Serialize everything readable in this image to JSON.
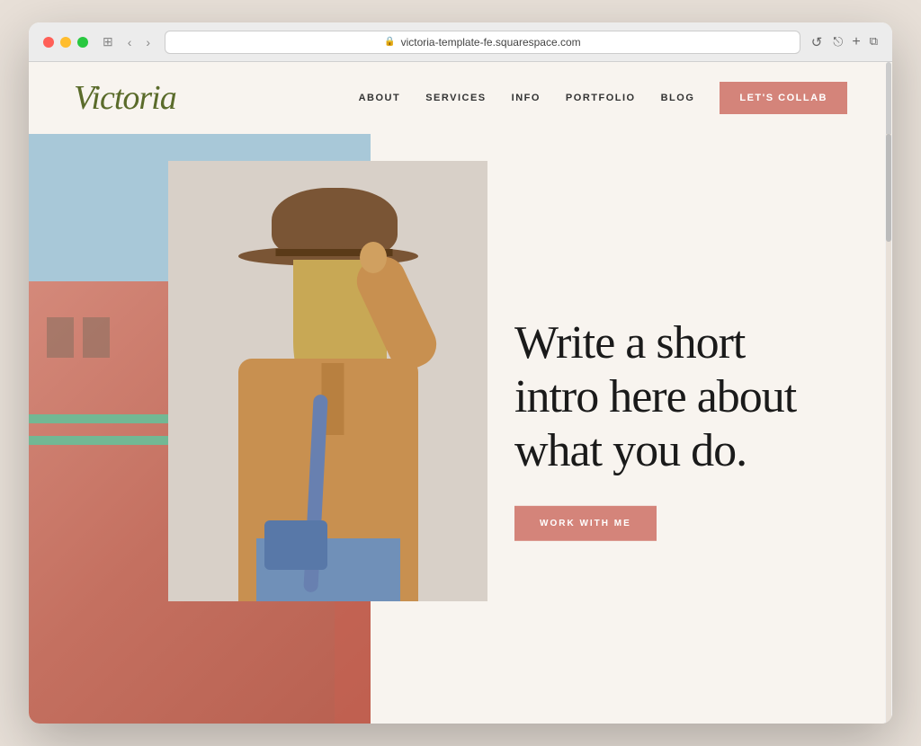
{
  "browser": {
    "url": "victoria-template-fe.squarespace.com",
    "reload_label": "↺",
    "back_label": "‹",
    "forward_label": "›",
    "window_icon": "⊞"
  },
  "header": {
    "logo": "Victoria",
    "nav": {
      "about_label": "ABOUT",
      "services_label": "SERVICES",
      "info_label": "INFO",
      "portfolio_label": "PORTFOLIO",
      "blog_label": "BLOG",
      "cta_label": "LET'S COLLAB"
    }
  },
  "hero": {
    "headline": "Write a short intro here about what you do.",
    "cta_label": "WORK WITH ME"
  },
  "colors": {
    "accent": "#d4847a",
    "logo_green": "#5a6b2a",
    "bg_cream": "#f8f4ef",
    "text_dark": "#1a1a1a"
  }
}
